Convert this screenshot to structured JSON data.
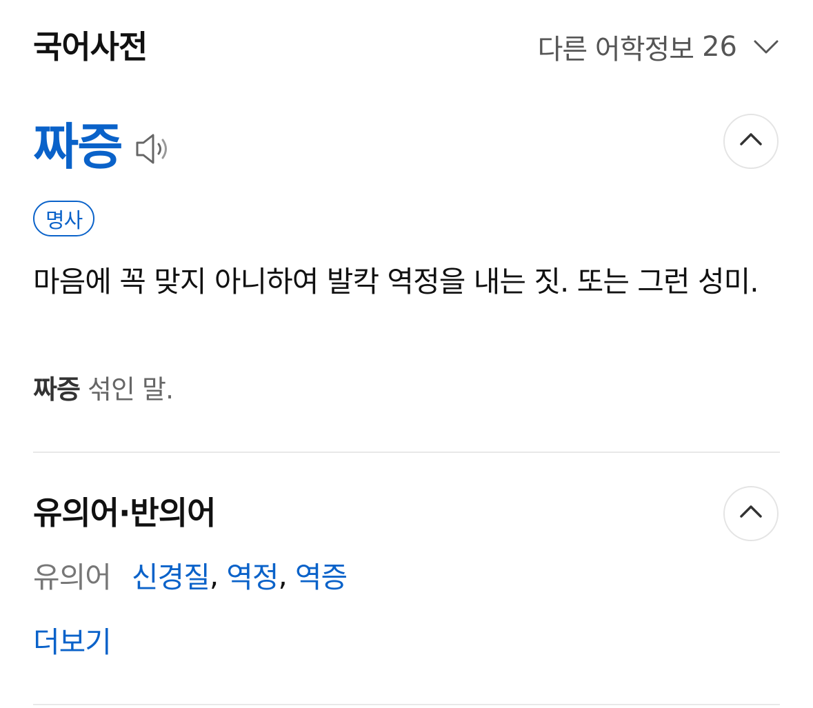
{
  "header": {
    "title": "국어사전",
    "other_info_label": "다른 어학정보",
    "other_info_count": "26"
  },
  "entry": {
    "word": "짜증",
    "part_of_speech": "명사",
    "definition": "마음에 꼭 맞지 아니하여 발칵 역정을 내는 짓. 또는 그런 성미.",
    "etymology_word": "짜증",
    "etymology_rest": " 섞인 말."
  },
  "synonyms_section": {
    "title": "유의어·반의어",
    "synonym_label": "유의어",
    "synonyms": [
      "신경질",
      "역정",
      "역증"
    ],
    "more_label": "더보기"
  },
  "colors": {
    "accent": "#0a62c9",
    "text": "#111111",
    "muted": "#666666",
    "divider": "#e8e8e8"
  },
  "icons": {
    "speaker": "speaker-icon",
    "chevron_down": "chevron-down-icon",
    "chevron_up": "chevron-up-icon"
  }
}
